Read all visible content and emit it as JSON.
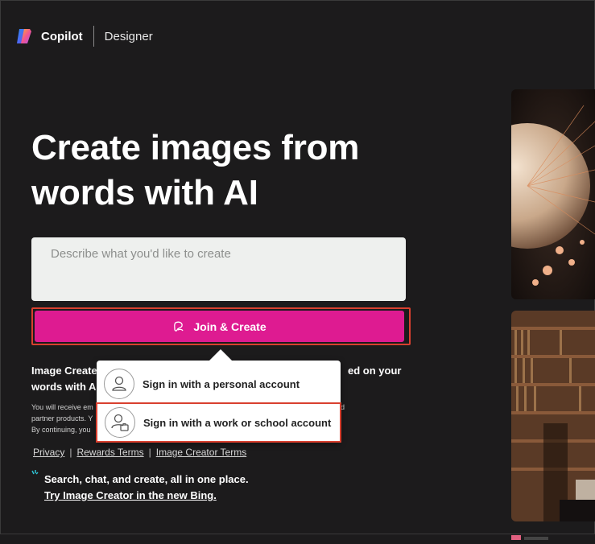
{
  "brand": {
    "name": "Copilot",
    "product": "Designer"
  },
  "hero": {
    "line1": "Create images from",
    "line2": "words with AI"
  },
  "prompt": {
    "placeholder": "Describe what you'd like to create"
  },
  "create_button": {
    "label": "Join & Create"
  },
  "info": {
    "title_left": "Image Create",
    "title_right": "ed on your",
    "title_line2": "words with A",
    "fine1": "You will receive em",
    "fine1_tail": "d",
    "fine2": "partner products. Y",
    "fine3": "By continuing, you"
  },
  "links": [
    "Privacy",
    "Rewards Terms",
    "Image Creator Terms"
  ],
  "promo": {
    "line1": "Search, chat, and create, all in one place.",
    "line2": "Try Image Creator in the new Bing."
  },
  "signin": {
    "personal": "Sign in with a personal account",
    "work": "Sign in with a work or school account"
  },
  "colors": {
    "accent": "#de1b91",
    "highlight": "#d9402f",
    "background": "#1c1b1c"
  }
}
